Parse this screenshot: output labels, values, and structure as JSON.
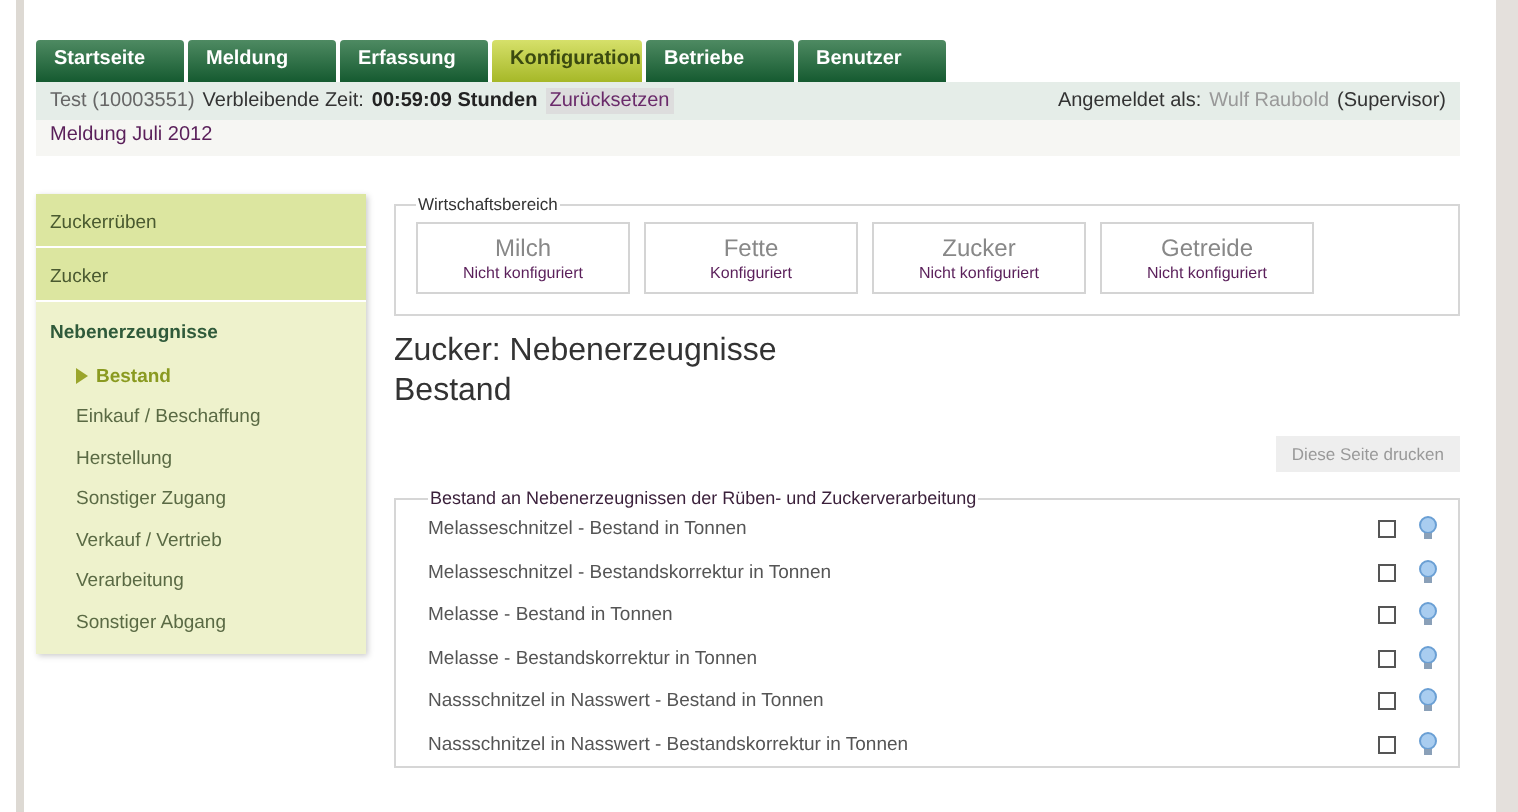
{
  "tabs": [
    {
      "label": "Startseite",
      "selected": false
    },
    {
      "label": "Meldung",
      "selected": false
    },
    {
      "label": "Erfassung",
      "selected": false
    },
    {
      "label": "Konfiguration",
      "selected": true
    },
    {
      "label": "Betriebe",
      "selected": false
    },
    {
      "label": "Benutzer",
      "selected": false
    }
  ],
  "info_bar": {
    "account": "Test (10003551)",
    "remaining_label": "Verbleibende Zeit:",
    "remaining_time": "00:59:09 Stunden",
    "reset": "Zurücksetzen",
    "logged_in_label": "Angemeldet als:",
    "user_name": "Wulf Raubold",
    "role": "(Supervisor)"
  },
  "report_title": "Meldung Juli 2012",
  "sidebar": {
    "groups": [
      {
        "label": "Zuckerrüben",
        "expanded": false
      },
      {
        "label": "Zucker",
        "expanded": false
      },
      {
        "label": "Nebenerzeugnisse",
        "expanded": true,
        "children": [
          {
            "label": "Bestand",
            "selected": true
          },
          {
            "label": "Einkauf / Beschaffung",
            "selected": false
          },
          {
            "label": "Herstellung",
            "selected": false
          },
          {
            "label": "Sonstiger Zugang",
            "selected": false
          },
          {
            "label": "Verkauf / Vertrieb",
            "selected": false
          },
          {
            "label": "Verarbeitung",
            "selected": false
          },
          {
            "label": "Sonstiger Abgang",
            "selected": false
          }
        ]
      }
    ]
  },
  "sector_panel": {
    "legend": "Wirtschaftsbereich",
    "sectors": [
      {
        "name": "Milch",
        "status": "Nicht konfiguriert"
      },
      {
        "name": "Fette",
        "status": "Konfiguriert"
      },
      {
        "name": "Zucker",
        "status": "Nicht konfiguriert"
      },
      {
        "name": "Getreide",
        "status": "Nicht konfiguriert"
      }
    ]
  },
  "heading": {
    "title": "Zucker: Nebenerzeugnisse",
    "subtitle": "Bestand"
  },
  "print_button": {
    "label": "Diese Seite drucken",
    "disabled": true
  },
  "stock_panel": {
    "legend": "Bestand an Nebenerzeugnissen der Rüben- und Zuckerverarbeitung",
    "rows": [
      {
        "label": "Melasseschnitzel - Bestand in Tonnen",
        "checked": false
      },
      {
        "label": "Melasseschnitzel - Bestandskorrektur in Tonnen",
        "checked": false
      },
      {
        "label": "Melasse - Bestand in Tonnen",
        "checked": false
      },
      {
        "label": "Melasse - Bestandskorrektur in Tonnen",
        "checked": false
      },
      {
        "label": "Nassschnitzel in Nasswert - Bestand in Tonnen",
        "checked": false
      },
      {
        "label": "Nassschnitzel in Nasswert - Bestandskorrektur in Tonnen",
        "checked": false
      }
    ]
  }
}
